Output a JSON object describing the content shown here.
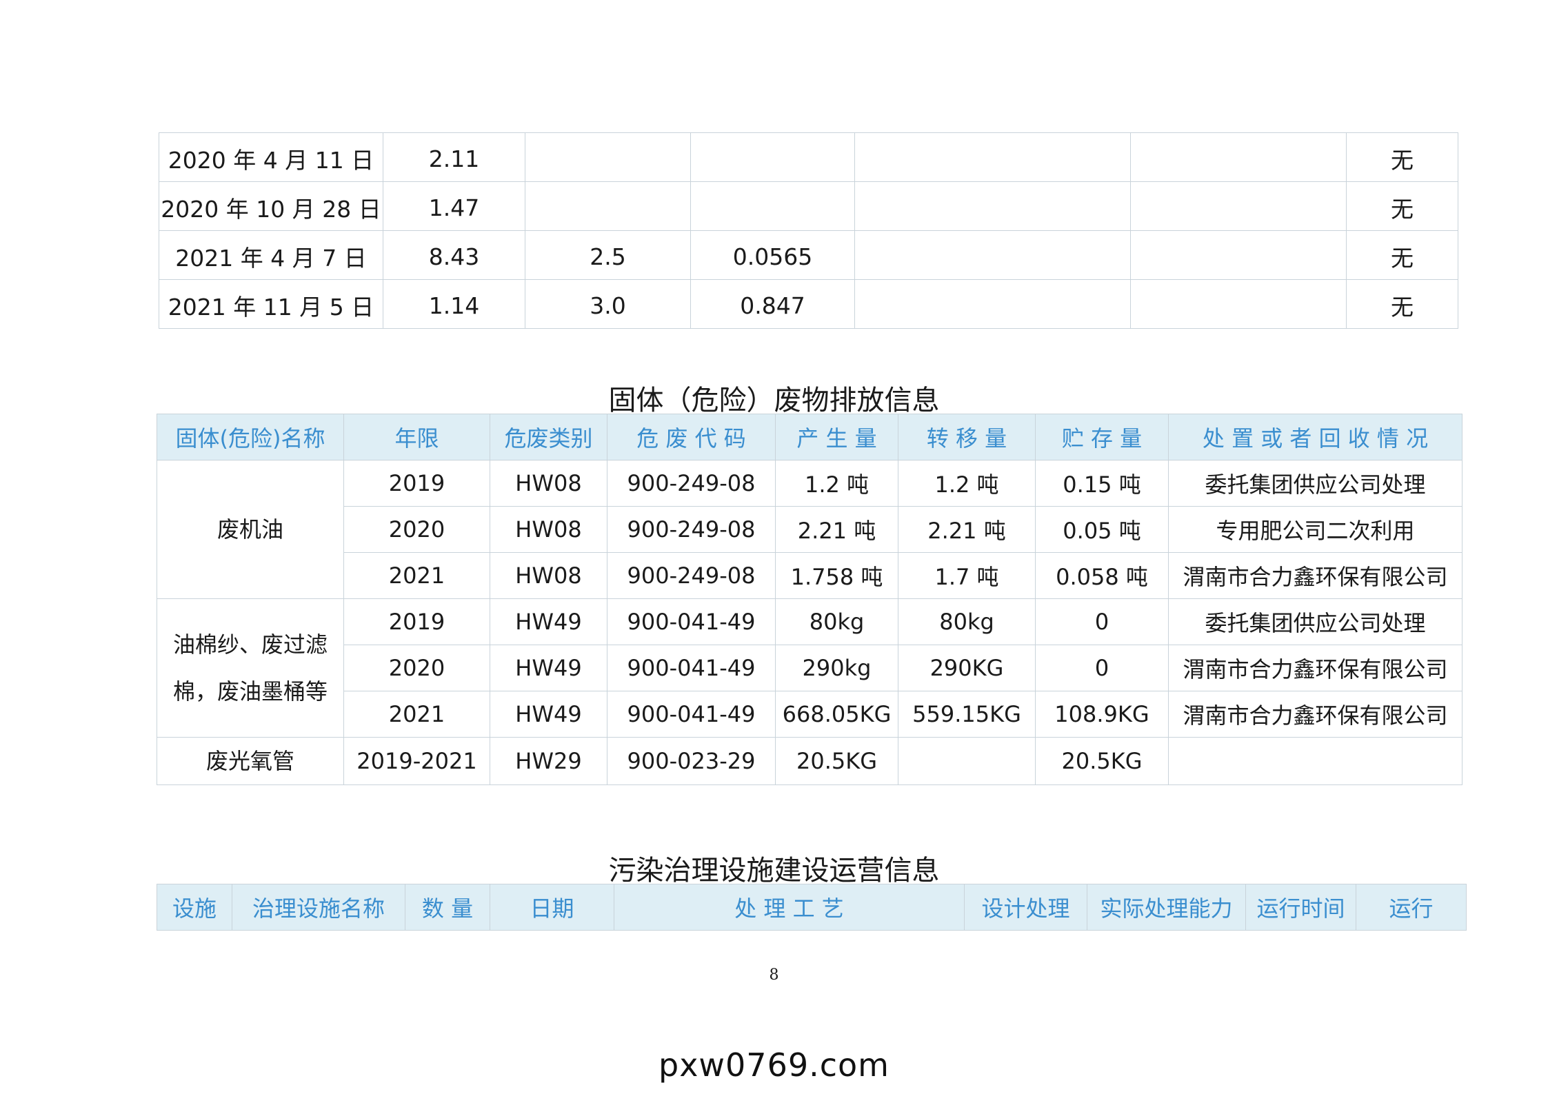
{
  "top_table": {
    "rows": [
      [
        "2020 年 4 月 11 日",
        "2.11",
        "",
        "",
        "",
        "",
        "无"
      ],
      [
        "2020 年 10 月 28 日",
        "1.47",
        "",
        "",
        "",
        "",
        "无"
      ],
      [
        "2021 年 4 月 7 日",
        "8.43",
        "2.5",
        "0.0565",
        "",
        "",
        "无"
      ],
      [
        "2021 年 11 月 5 日",
        "1.14",
        "3.0",
        "0.847",
        "",
        "",
        "无"
      ]
    ]
  },
  "hazardous_section": {
    "title": "固体（危险）废物排放信息",
    "headers": [
      "固体(危险)名称",
      "年限",
      "危废类别",
      "危 废 代 码",
      "产 生 量",
      "转 移 量",
      "贮 存 量",
      "处 置 或 者 回 收 情 况"
    ],
    "groups": [
      {
        "name": "废机油",
        "rows": [
          [
            "2019",
            "HW08",
            "900-249-08",
            "1.2 吨",
            "1.2 吨",
            "0.15 吨",
            "委托集团供应公司处理"
          ],
          [
            "2020",
            "HW08",
            "900-249-08",
            "2.21 吨",
            "2.21 吨",
            "0.05 吨",
            "专用肥公司二次利用"
          ],
          [
            "2021",
            "HW08",
            "900-249-08",
            "1.758 吨",
            "1.7 吨",
            "0.058 吨",
            "渭南市合力鑫环保有限公司"
          ]
        ]
      },
      {
        "name": "油棉纱、废过滤棉，废油墨桶等",
        "rows": [
          [
            "2019",
            "HW49",
            "900-041-49",
            "80kg",
            "80kg",
            "0",
            "委托集团供应公司处理"
          ],
          [
            "2020",
            "HW49",
            "900-041-49",
            "290kg",
            "290KG",
            "0",
            "渭南市合力鑫环保有限公司"
          ],
          [
            "2021",
            "HW49",
            "900-041-49",
            "668.05KG",
            "559.15KG",
            "108.9KG",
            "渭南市合力鑫环保有限公司"
          ]
        ]
      },
      {
        "name": "废光氧管",
        "rows": [
          [
            "2019-2021",
            "HW29",
            "900-023-29",
            "20.5KG",
            "",
            "20.5KG",
            ""
          ]
        ]
      }
    ]
  },
  "facility_section": {
    "title": "污染治理设施建设运营信息",
    "headers": [
      "设施",
      "治理设施名称",
      "数 量",
      "日期",
      "处 理 工 艺",
      "设计处理",
      "实际处理能力",
      "运行时间",
      "运行"
    ]
  },
  "page_number": "8",
  "watermark": "pxw0769.com"
}
